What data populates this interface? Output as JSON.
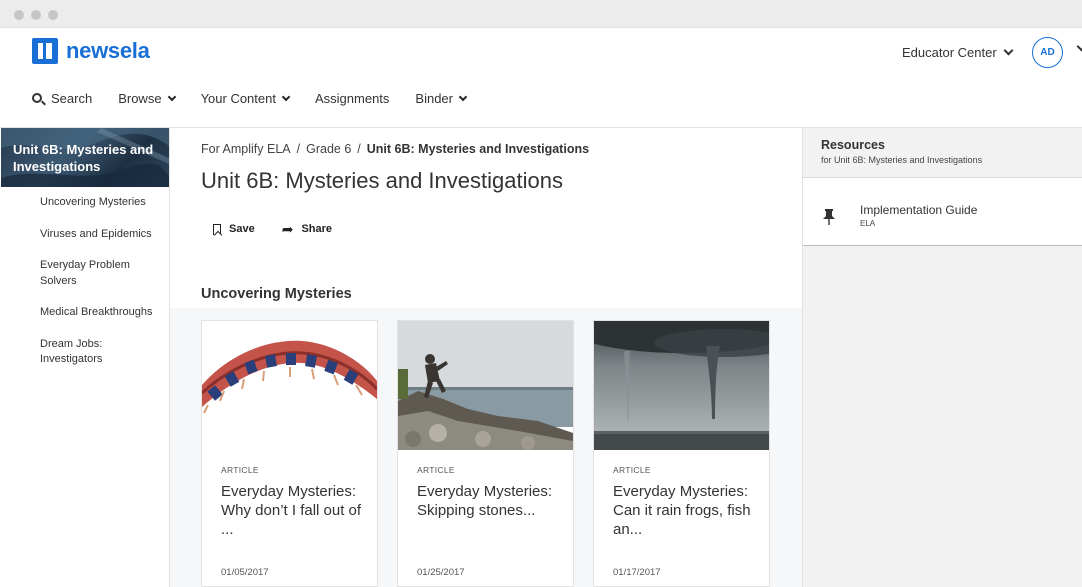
{
  "brand": {
    "name": "newsela",
    "color": "#1a6fd6"
  },
  "header": {
    "educator_center": "Educator Center",
    "avatar_initials": "AD"
  },
  "nav": {
    "search": "Search",
    "browse": "Browse",
    "your_content": "Your Content",
    "assignments": "Assignments",
    "binder": "Binder"
  },
  "sidebar": {
    "hero_title": "Unit 6B: Mysteries and Investigations",
    "items": [
      {
        "label": "Uncovering Mysteries"
      },
      {
        "label": "Viruses and Epidemics"
      },
      {
        "label": "Everyday Problem Solvers"
      },
      {
        "label": "Medical Breakthroughs"
      },
      {
        "label": "Dream Jobs: Investigators"
      }
    ]
  },
  "main": {
    "breadcrumb": [
      "For Amplify ELA",
      "Grade 6",
      "Unit 6B: Mysteries and Investigations"
    ],
    "title": "Unit 6B: Mysteries and Investigations",
    "save_label": "Save",
    "share_label": "Share",
    "section_title": "Uncovering Mysteries",
    "cards": [
      {
        "type": "ARTICLE",
        "title": "Everyday Mysteries: Why don’t I fall out of ...",
        "date": "01/05/2017",
        "image": "roller-coaster-loop"
      },
      {
        "type": "ARTICLE",
        "title": "Everyday Mysteries: Skipping stones...",
        "date": "01/25/2017",
        "image": "boy-skipping-stones"
      },
      {
        "type": "ARTICLE",
        "title": "Everyday Mysteries: Can it rain frogs, fish an...",
        "date": "01/17/2017",
        "image": "waterspout-storm"
      }
    ]
  },
  "resources": {
    "title": "Resources",
    "subtitle": "for Unit 6B: Mysteries and Investigations",
    "items": [
      {
        "title": "Implementation Guide",
        "subtitle": "ELA",
        "icon": "pin-icon"
      }
    ]
  }
}
